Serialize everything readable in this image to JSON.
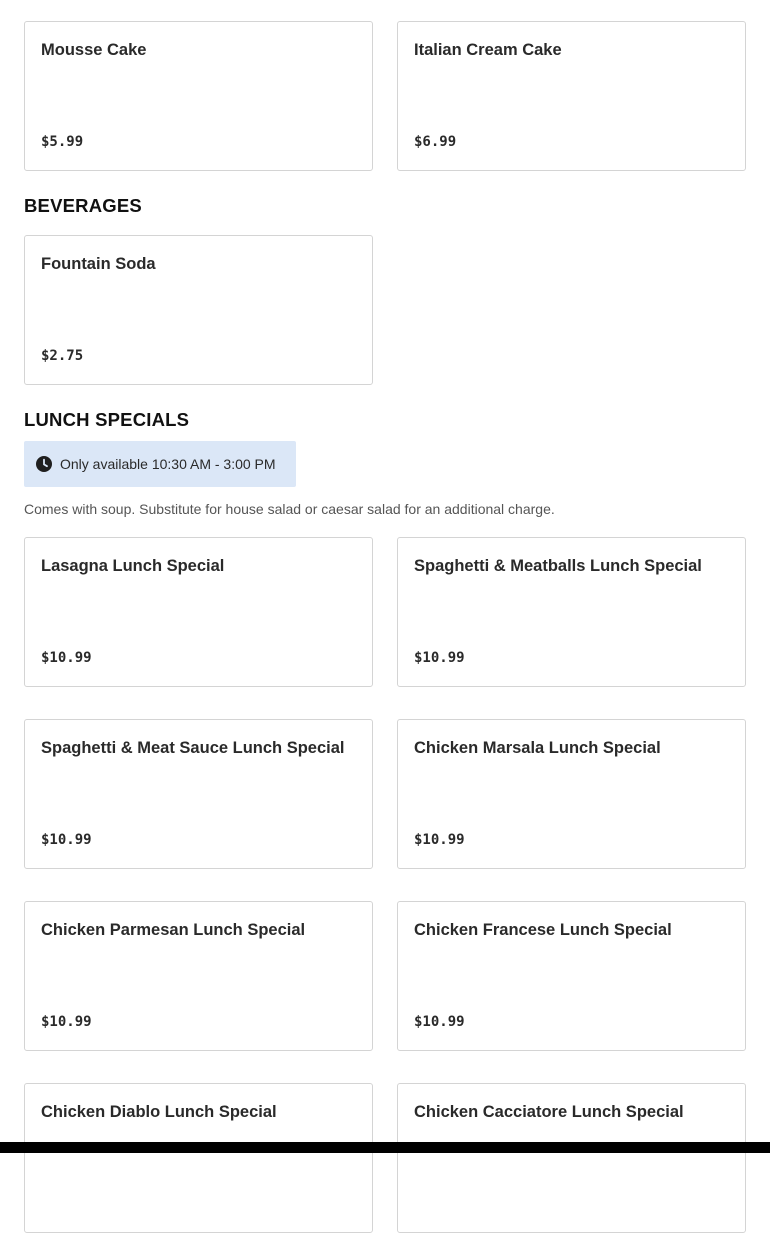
{
  "desserts": [
    {
      "name": "Mousse Cake",
      "price": "$5.99"
    },
    {
      "name": "Italian Cream Cake",
      "price": "$6.99"
    }
  ],
  "beverages": {
    "title": "BEVERAGES",
    "items": [
      {
        "name": "Fountain Soda",
        "price": "$2.75"
      }
    ]
  },
  "lunch_specials": {
    "title": "LUNCH SPECIALS",
    "availability": "Only available 10:30 AM - 3:00 PM",
    "availability_icon": "clock-icon",
    "description": "Comes with soup. Substitute for house salad or caesar salad for an additional charge.",
    "items": [
      {
        "name": "Lasagna Lunch Special",
        "price": "$10.99"
      },
      {
        "name": "Spaghetti & Meatballs Lunch Special",
        "price": "$10.99"
      },
      {
        "name": "Spaghetti & Meat Sauce Lunch Special",
        "price": "$10.99"
      },
      {
        "name": "Chicken Marsala Lunch Special",
        "price": "$10.99"
      },
      {
        "name": "Chicken Parmesan Lunch Special",
        "price": "$10.99"
      },
      {
        "name": "Chicken Francese Lunch Special",
        "price": "$10.99"
      },
      {
        "name": "Chicken Diablo Lunch Special"
      },
      {
        "name": "Chicken Cacciatore Lunch Special"
      }
    ]
  }
}
